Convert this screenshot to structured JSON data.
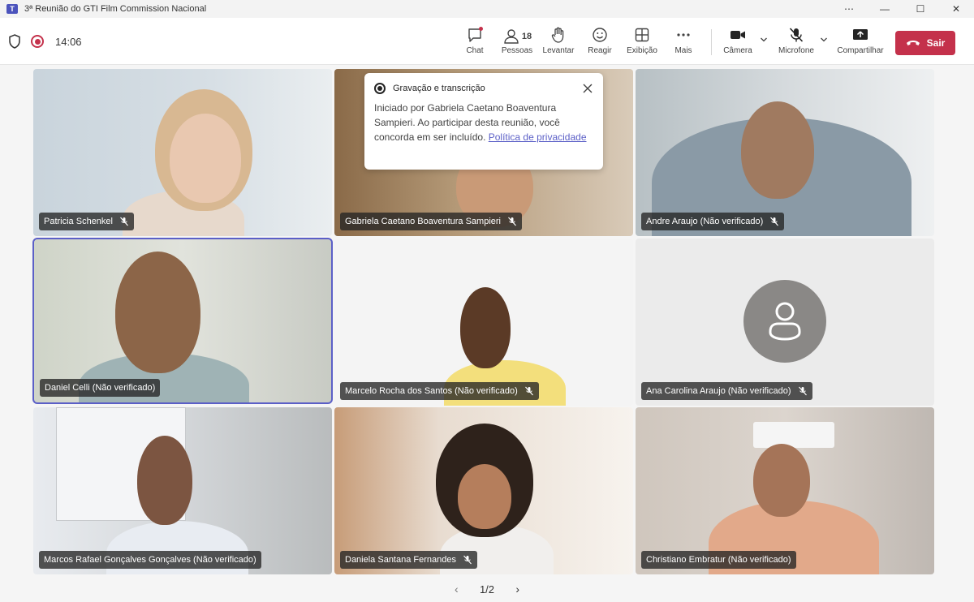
{
  "window": {
    "title": "3ª Reunião do GTI Film Commission Nacional",
    "controls": [
      "more-icon",
      "minimize-icon",
      "maximize-icon",
      "close-icon"
    ]
  },
  "toolbar": {
    "timer": "14:06",
    "chat": "Chat",
    "people": "Pessoas",
    "people_count": "18",
    "raise": "Levantar",
    "react": "Reagir",
    "view": "Exibição",
    "more": "Mais",
    "camera": "Câmera",
    "mic": "Microfone",
    "share": "Compartilhar",
    "leave": "Sair"
  },
  "popup": {
    "title": "Gravação e transcrição",
    "text": "Iniciado por Gabriela Caetano Boaventura Sampieri. Ao participar desta reunião, você concorda em ser incluído.",
    "link": "Política de privacidade"
  },
  "participants": [
    {
      "name": "Patricia Schenkel",
      "muted": true
    },
    {
      "name": "Gabriela Caetano Boaventura Sampieri",
      "muted": true
    },
    {
      "name": "Andre Araujo (Não verificado)",
      "muted": true
    },
    {
      "name": "Daniel Celli (Não verificado)",
      "muted": false,
      "speaking": true
    },
    {
      "name": "Marcelo Rocha dos Santos (Não verificado)",
      "muted": true
    },
    {
      "name": "Ana Carolina Araujo (Não verificado)",
      "muted": true,
      "camera_off": true
    },
    {
      "name": "Marcos Rafael Gonçalves Gonçalves (Não verificado)",
      "muted": false
    },
    {
      "name": "Daniela Santana Fernandes",
      "muted": true
    },
    {
      "name": "Christiano Embratur (Não verificado)",
      "muted": false
    }
  ],
  "pager": {
    "label": "1/2"
  },
  "colors": {
    "accent": "#5b5fc7",
    "leave": "#c4314b"
  }
}
